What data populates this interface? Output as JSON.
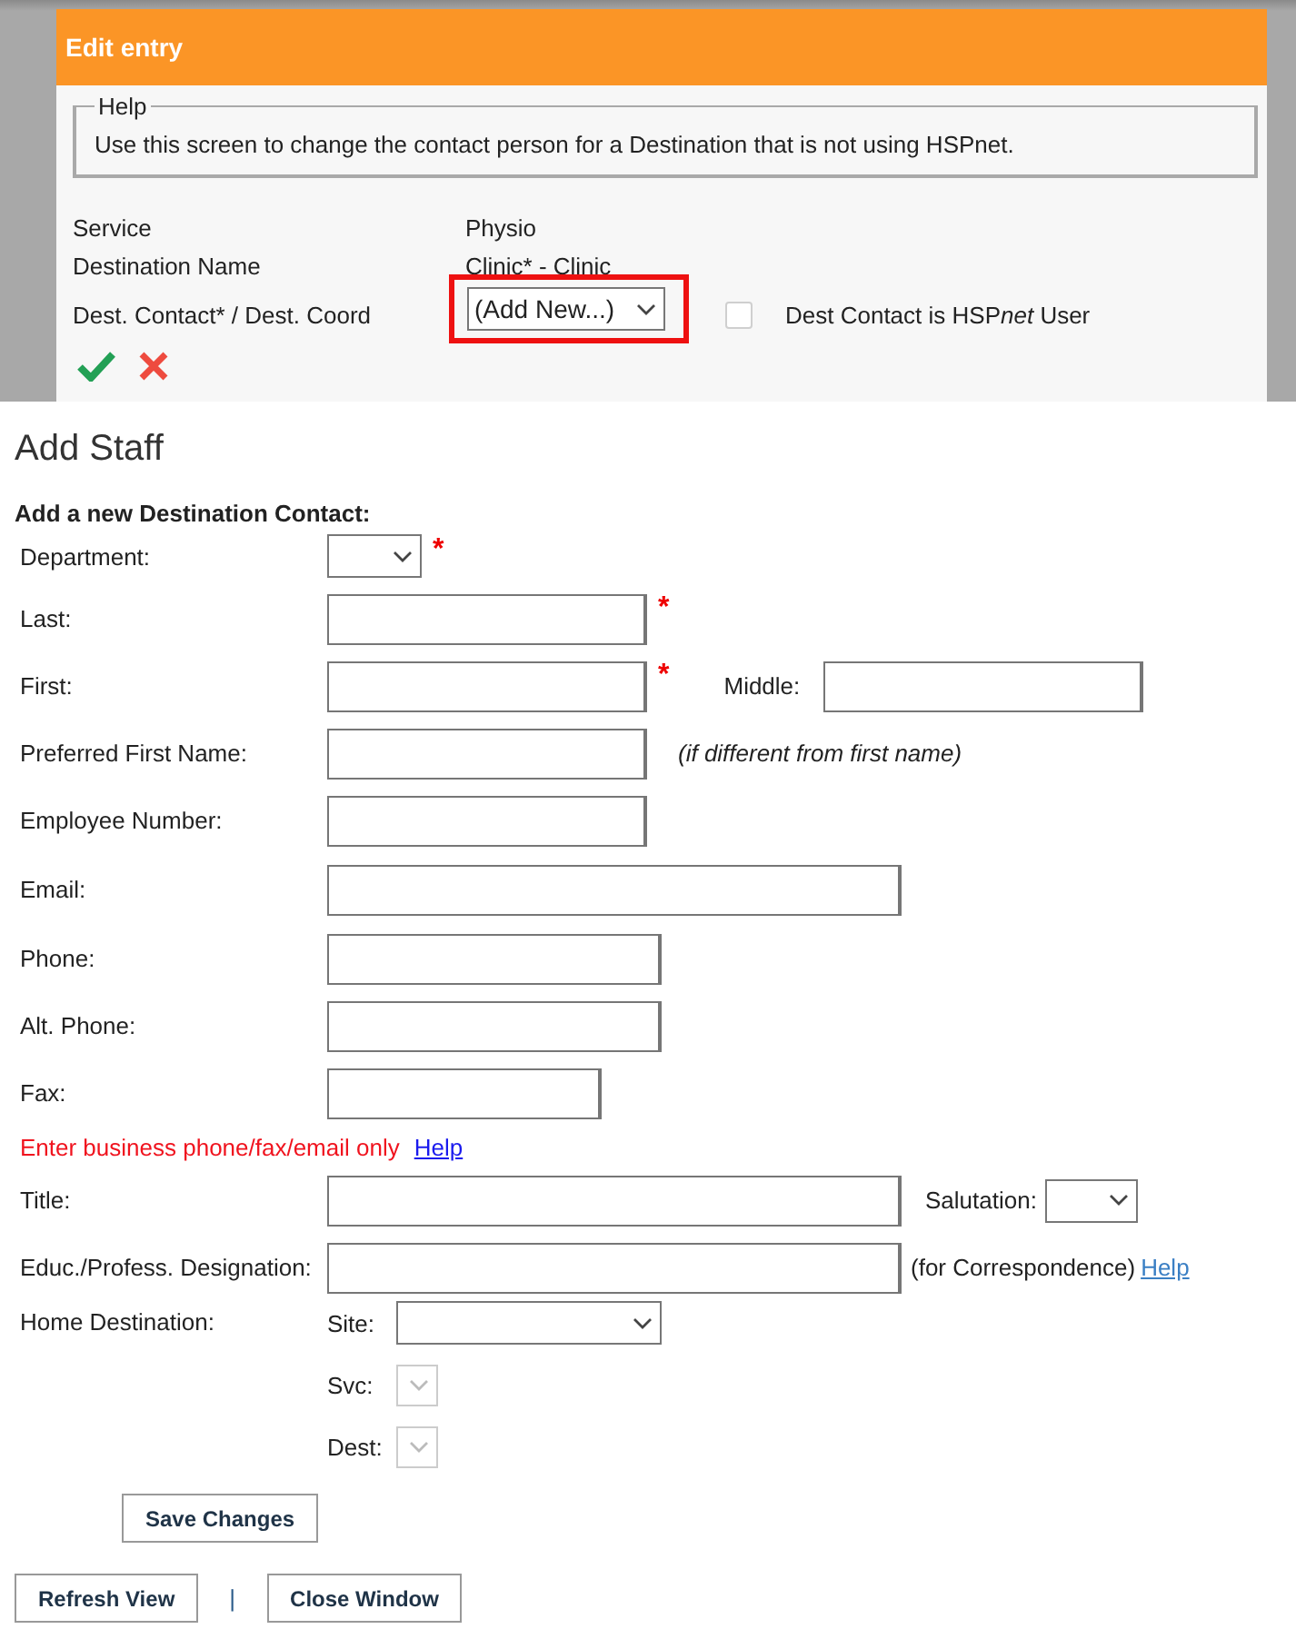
{
  "edit_entry": {
    "title": "Edit entry",
    "help": {
      "legend": "Help",
      "text": "Use this screen to change the contact person for a Destination that is not using HSPnet."
    },
    "info": [
      {
        "label": "Service",
        "value": "Physio"
      },
      {
        "label": "Destination Name",
        "value": "Clinic* - Clinic"
      }
    ],
    "contact": {
      "label": "Dest. Contact* / Dest. Coord",
      "value": "(Add New...)",
      "highlighted": true,
      "checkbox": {
        "label_parts": [
          {
            "text": "Dest Contact is HSP",
            "italic": false
          },
          {
            "text": "net",
            "italic": true
          },
          {
            "text": " User",
            "italic": false
          }
        ],
        "checked": false
      }
    }
  },
  "add_staff": {
    "title": "Add Staff",
    "subtitle": "Add a new Destination Contact:",
    "required_mark": "*",
    "rows": [
      {
        "label": "Department:",
        "kind": "select",
        "required": true
      },
      {
        "label": "Last:",
        "kind": "text",
        "required": true
      },
      {
        "label": "First:",
        "kind": "text",
        "required": true,
        "extra": {
          "kind": "field",
          "label": "Middle:"
        }
      },
      {
        "label": "Preferred First Name:",
        "kind": "text",
        "required": false,
        "extra": {
          "kind": "note",
          "text": "(if different from first name)"
        }
      },
      {
        "label": "Employee Number:",
        "kind": "text",
        "required": false
      },
      {
        "label": "Email:",
        "kind": "text",
        "required": false
      },
      {
        "label": "Phone:",
        "kind": "text",
        "required": false
      },
      {
        "label": "Alt. Phone:",
        "kind": "text",
        "required": false
      },
      {
        "label": "Fax:",
        "kind": "text",
        "required": false
      },
      {
        "kind": "notice",
        "text": "Enter business phone/fax/email only",
        "link": "Help"
      },
      {
        "label": "Title:",
        "kind": "text",
        "required": false,
        "extra": {
          "kind": "select",
          "label": "Salutation:"
        }
      },
      {
        "label": "Educ./Profess. Designation:",
        "kind": "text",
        "required": false,
        "extra": {
          "kind": "help",
          "text": "(for Correspondence)",
          "link": "Help"
        }
      }
    ],
    "home_destination": {
      "label": "Home Destination:",
      "selects": [
        {
          "label": "Site:",
          "disabled": false
        },
        {
          "label": "Svc:",
          "disabled": true
        },
        {
          "label": "Dest:",
          "disabled": true
        }
      ]
    },
    "save_button": "Save Changes"
  },
  "footer": {
    "buttons": [
      "Refresh View",
      "Close Window"
    ],
    "separator": "|"
  }
}
